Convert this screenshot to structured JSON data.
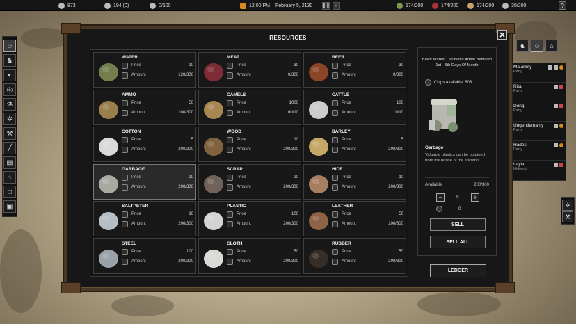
{
  "topbar": {
    "chips": "873",
    "influence": "194 (0)",
    "deaths": "0/500",
    "time": "12:00 PM",
    "date": "February 5, 2130",
    "stat_camel": "174/200",
    "stat_meat": "174/200",
    "stat_ammo": "174/200",
    "stat_people": "30/200",
    "help_label": "?"
  },
  "dialog": {
    "title": "RESOURCES",
    "close_label": "✕"
  },
  "price_label": "Price",
  "amount_label": "Amount",
  "resources": [
    {
      "name": "WATER",
      "price": "10",
      "amount": "120/300"
    },
    {
      "name": "MEAT",
      "price": "30",
      "amount": "0/300"
    },
    {
      "name": "BEER",
      "price": "30",
      "amount": "0/300"
    },
    {
      "name": "AMMO",
      "price": "50",
      "amount": "100/300"
    },
    {
      "name": "CAMELS",
      "price": "1000",
      "amount": "60/10"
    },
    {
      "name": "CATTLE",
      "price": "100",
      "amount": "0/10"
    },
    {
      "name": "COTTON",
      "price": "5",
      "amount": "200/300"
    },
    {
      "name": "WOOD",
      "price": "10",
      "amount": "200/300"
    },
    {
      "name": "BARLEY",
      "price": "5",
      "amount": "200/300"
    },
    {
      "name": "GARBAGE",
      "price": "10",
      "amount": "200/300"
    },
    {
      "name": "SCRAP",
      "price": "20",
      "amount": "200/300"
    },
    {
      "name": "HIDE",
      "price": "10",
      "amount": "200/300"
    },
    {
      "name": "SALTPETER",
      "price": "10",
      "amount": "200/300"
    },
    {
      "name": "PLASTIC",
      "price": "100",
      "amount": "200/300"
    },
    {
      "name": "LEATHER",
      "price": "50",
      "amount": "200/300"
    },
    {
      "name": "STEEL",
      "price": "100",
      "amount": "200/300"
    },
    {
      "name": "CLOTH",
      "price": "50",
      "amount": "200/300"
    },
    {
      "name": "RUBBER",
      "price": "50",
      "amount": "200/300"
    }
  ],
  "detail": {
    "note": "Black Market Caravans Arrive Between 1st - 5th Days Of Month",
    "chips_available": "Chips Available: 608",
    "item_name": "Garbage",
    "item_desc": "Valuable plastics can be obtained from the refuse of the ancients.",
    "available_label": "Available",
    "available_value": "200/300",
    "minus_label": "−",
    "plus_label": "+",
    "quantity": "0",
    "chip_total": "0",
    "sell_label": "SELL",
    "sell_all_label": "SELL ALL",
    "ledger_label": "LEDGER"
  },
  "squads": [
    {
      "name": "Malarkey",
      "status": "Party"
    },
    {
      "name": "Rita",
      "status": "Party"
    },
    {
      "name": "Dong",
      "status": "Party"
    },
    {
      "name": "Ungentlemanly",
      "status": "Party"
    },
    {
      "name": "Hades",
      "status": "Party"
    },
    {
      "name": "Layla",
      "status": "Hideout"
    }
  ]
}
